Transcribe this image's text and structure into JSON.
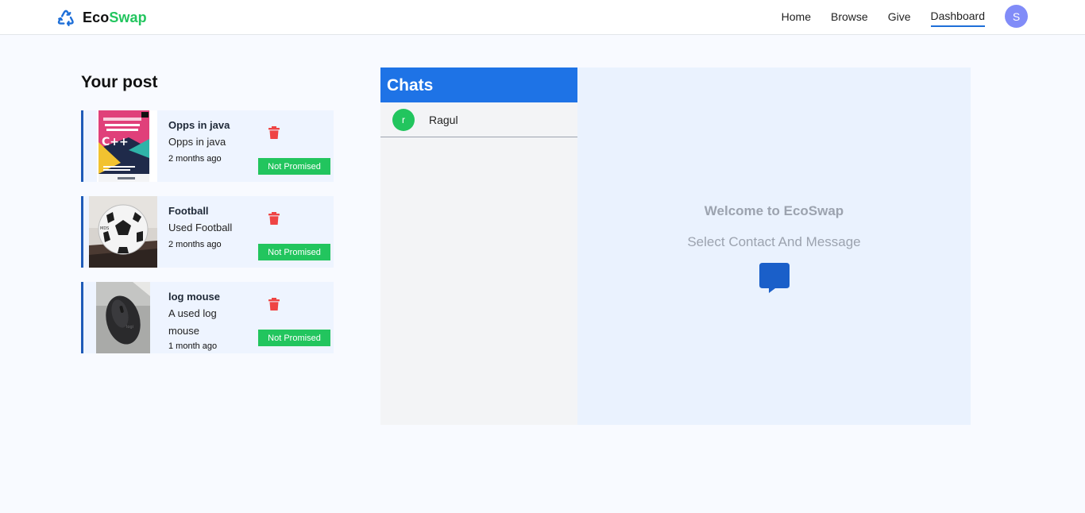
{
  "brand": {
    "name_part1": "Eco",
    "name_part2": "Swap",
    "accent_color": "#22c55e",
    "logo_icon": "recycle-icon"
  },
  "nav": {
    "items": [
      {
        "label": "Home",
        "active": false
      },
      {
        "label": "Browse",
        "active": false
      },
      {
        "label": "Give",
        "active": false
      },
      {
        "label": "Dashboard",
        "active": true
      }
    ],
    "avatar_initial": "S"
  },
  "posts": {
    "title": "Your post",
    "items": [
      {
        "name": "Opps in java",
        "description": "Opps in java",
        "time": "2 months ago",
        "status": "Not Promised",
        "image": "computer-science-book"
      },
      {
        "name": "Football",
        "description": "Used Football",
        "time": "2 months ago",
        "status": "Not Promised",
        "image": "football"
      },
      {
        "name": "log mouse",
        "description": "A used log mouse",
        "time": "1 month ago",
        "status": "Not Promised",
        "image": "computer-mouse"
      }
    ]
  },
  "chats": {
    "title": "Chats",
    "contacts": [
      {
        "initial": "r",
        "name": "Ragul"
      }
    ]
  },
  "welcome": {
    "title": "Welcome to EcoSwap",
    "subtitle": "Select Contact And Message",
    "icon": "message-icon"
  },
  "colors": {
    "primary": "#1e73e6",
    "success": "#22c55e",
    "danger": "#ef4444",
    "avatar": "#818cf8"
  }
}
